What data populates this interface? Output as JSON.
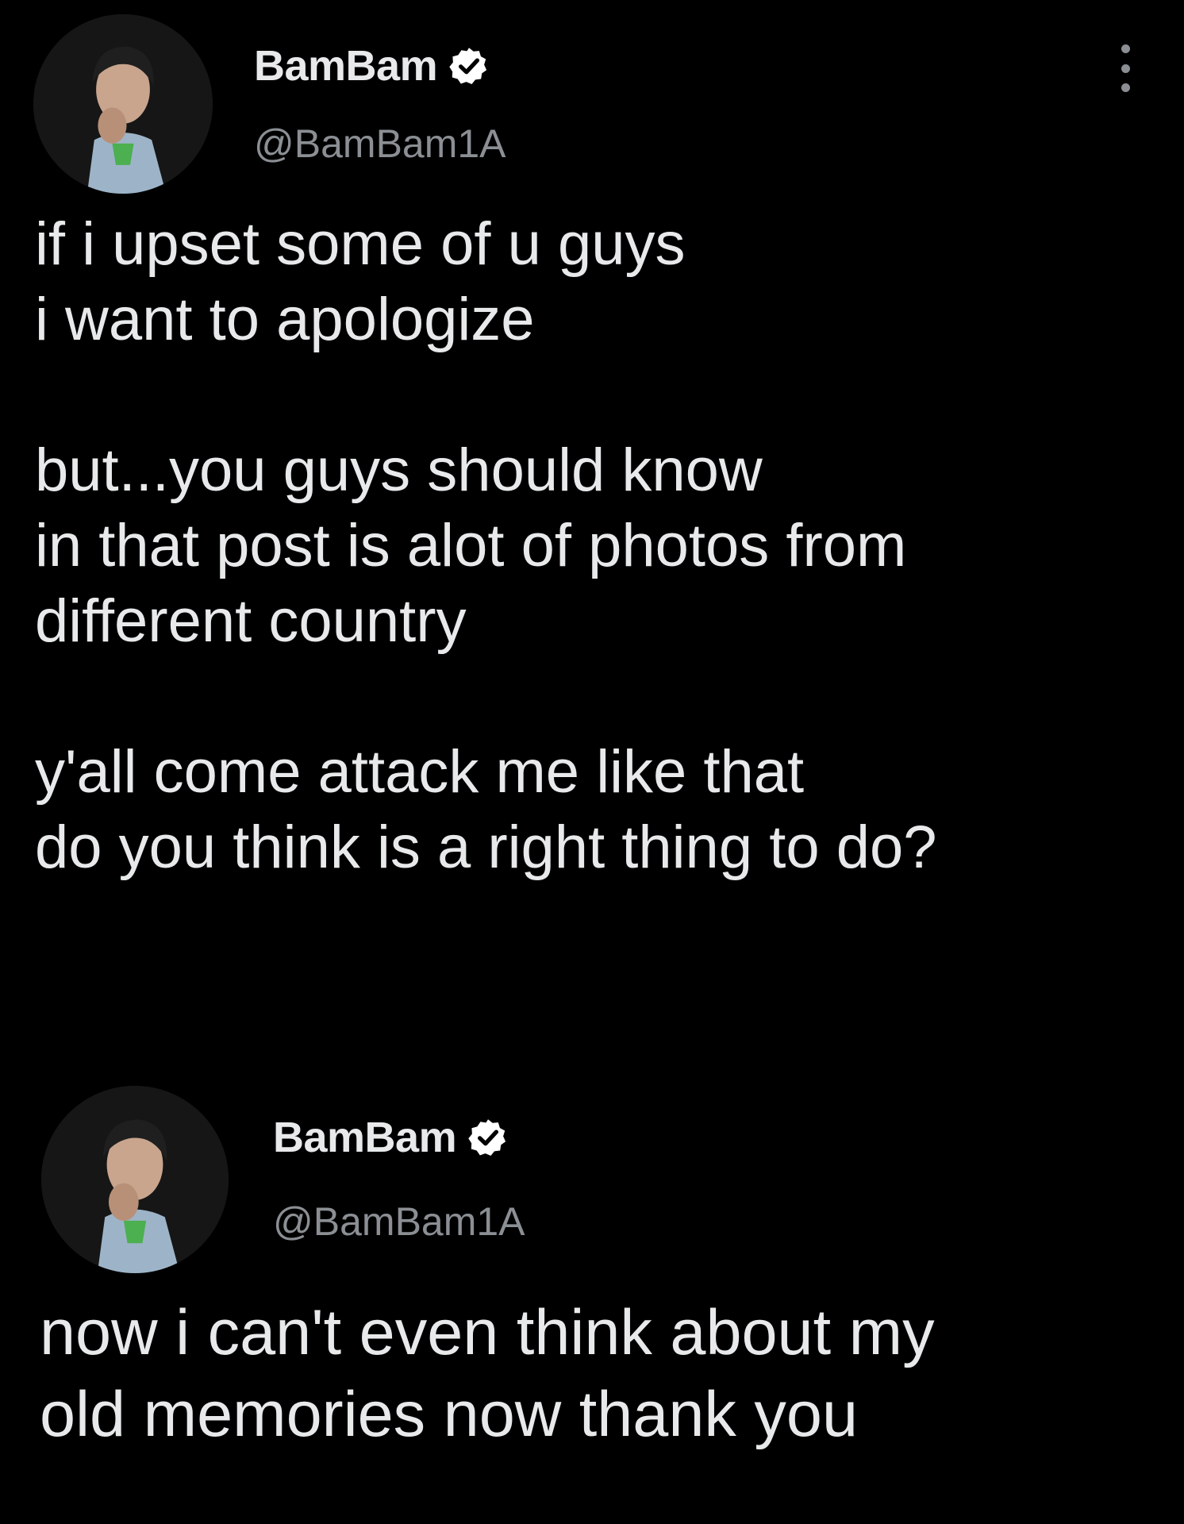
{
  "tweets": [
    {
      "author": {
        "display_name": "BamBam",
        "handle": "@BamBam1A",
        "verified": true,
        "avatar_icon": "profile-photo"
      },
      "more_icon": "more-vertical-icon",
      "text": "if i upset some of u guys\ni want to apologize\n\nbut...you guys should know\nin that post is alot of photos from\ndifferent country\n\ny'all come attack me like that\ndo you think is a right thing to do?"
    },
    {
      "author": {
        "display_name": "BamBam",
        "handle": "@BamBam1A",
        "verified": true,
        "avatar_icon": "profile-photo"
      },
      "text": "now i can't even think about my\nold memories now thank you"
    }
  ],
  "colors": {
    "background": "#000000",
    "text_primary": "#e7e9ea",
    "text_secondary": "#8b8f94",
    "verified_badge": "#ffffff"
  }
}
